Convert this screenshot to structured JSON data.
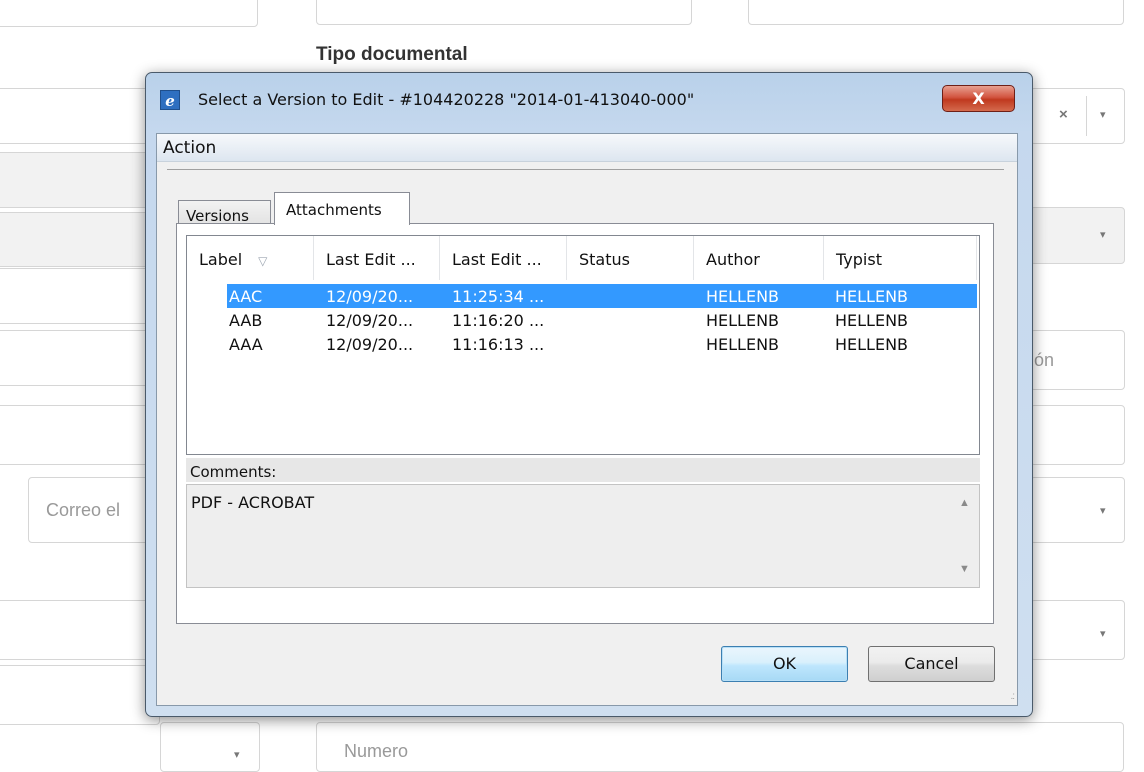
{
  "background": {
    "label_tipo_documental": "Tipo documental",
    "placeholder_correo": "Correo el",
    "placeholder_numero": "Numero",
    "fragment_on": "ón",
    "clear_symbol": "×",
    "dropdown_symbol": "▾"
  },
  "dialog": {
    "title": "Select a Version to Edit - #104420228 \"2014-01-413040-000\"",
    "close_label": "X",
    "menu": {
      "action": "Action"
    },
    "tabs": [
      {
        "label": "Versions",
        "active": false
      },
      {
        "label": "Attachments",
        "active": true
      }
    ],
    "columns": [
      "Label",
      "Last Edit ...",
      "Last Edit ...",
      "Status",
      "Author",
      "Typist"
    ],
    "rows": [
      {
        "label": "AAC",
        "date": "12/09/20...",
        "time": "11:25:34 ...",
        "status": "",
        "author": "HELLENB",
        "typist": "HELLENB",
        "selected": true
      },
      {
        "label": "AAB",
        "date": "12/09/20...",
        "time": "11:16:20 ...",
        "status": "",
        "author": "HELLENB",
        "typist": "HELLENB",
        "selected": false
      },
      {
        "label": "AAA",
        "date": "12/09/20...",
        "time": "11:16:13 ...",
        "status": "",
        "author": "HELLENB",
        "typist": "HELLENB",
        "selected": false
      }
    ],
    "comments_label": "Comments:",
    "comments_text": "PDF - ACROBAT",
    "ok_label": "OK",
    "cancel_label": "Cancel"
  },
  "colors": {
    "selection": "#3399ff",
    "title_bar": "#b9d1ea",
    "close_button": "#c0391f"
  }
}
